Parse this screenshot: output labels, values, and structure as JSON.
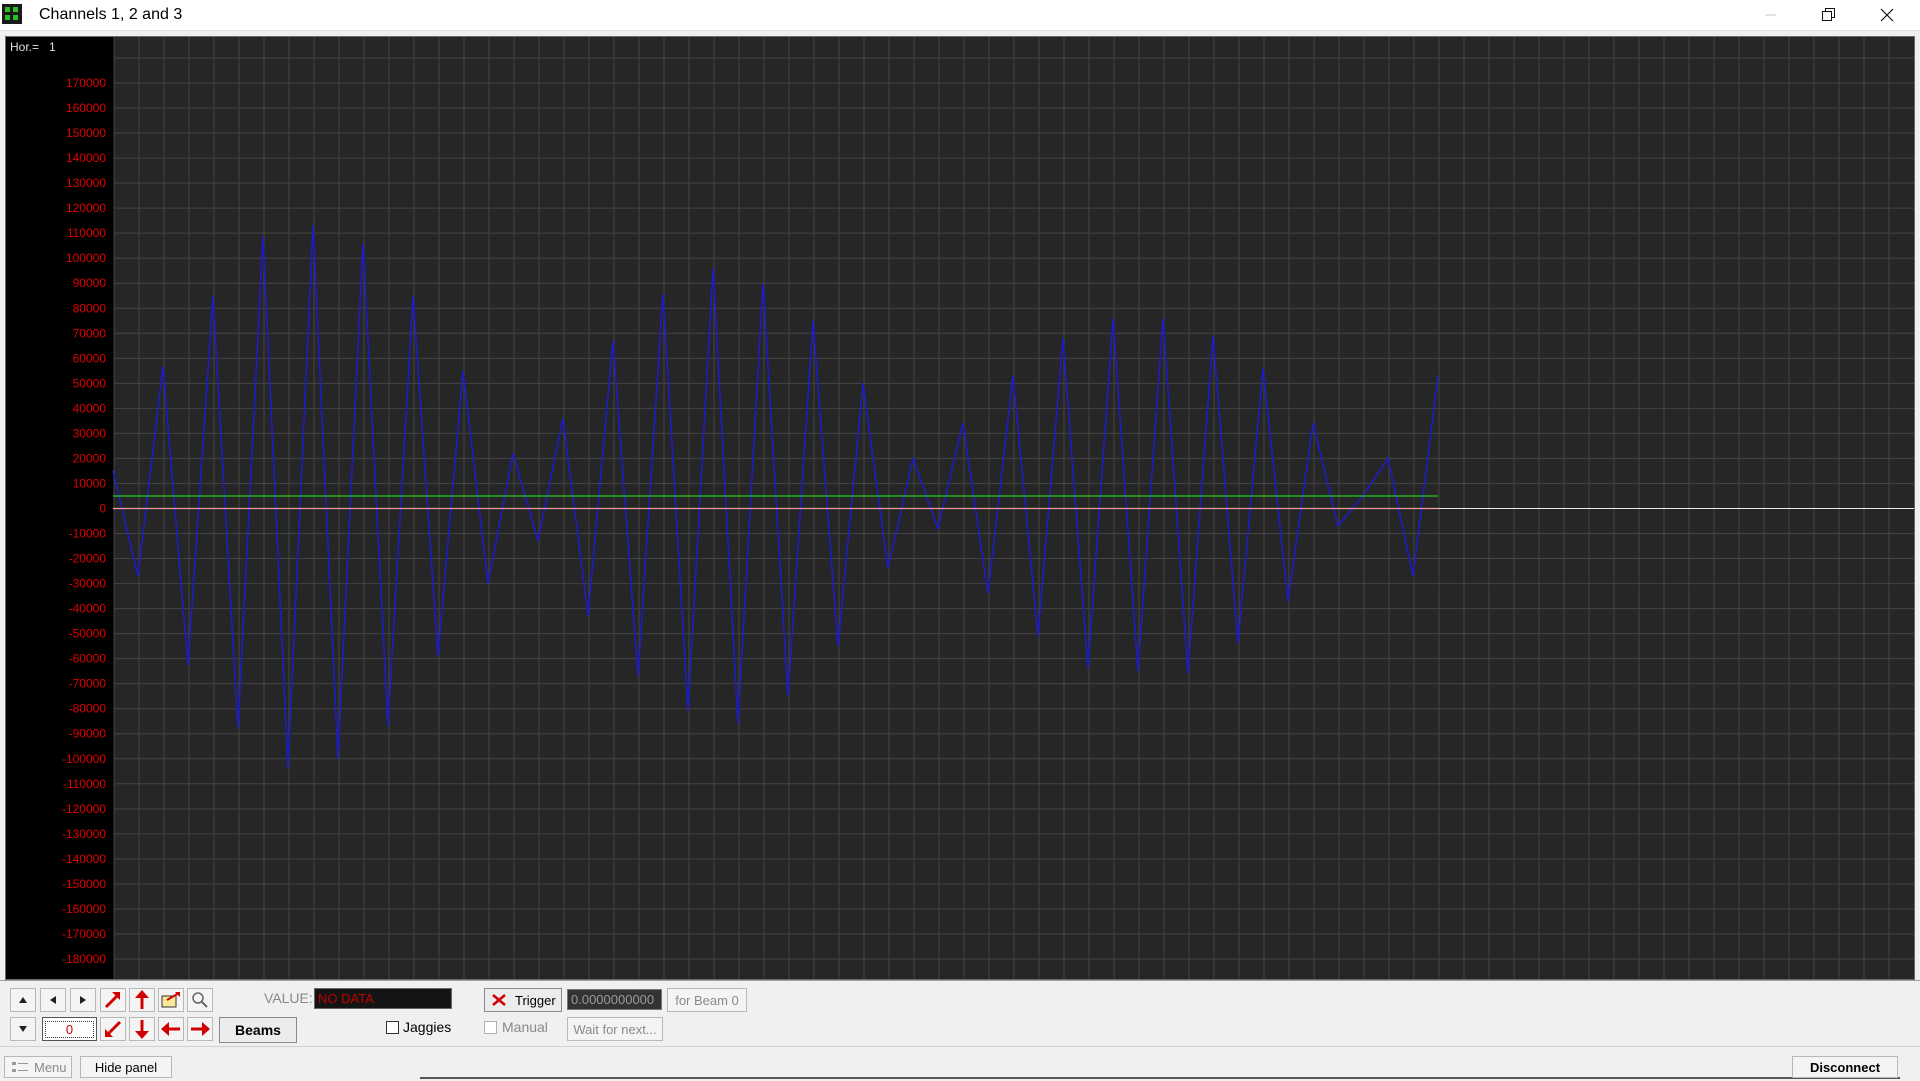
{
  "window": {
    "title": "Channels 1, 2 and 3"
  },
  "plot": {
    "hor_label": "Hor.=",
    "hor_value": "1"
  },
  "chart_data": {
    "type": "line",
    "ylim": [
      -180000,
      180000
    ],
    "ytick_step": 10000,
    "yticks": [
      "170000",
      "160000",
      "150000",
      "140000",
      "130000",
      "120000",
      "110000",
      "100000",
      "90000",
      "80000",
      "70000",
      "60000",
      "50000",
      "40000",
      "30000",
      "20000",
      "10000",
      "0",
      "-10000",
      "-20000",
      "-30000",
      "-40000",
      "-50000",
      "-60000",
      "-70000",
      "-80000",
      "-90000",
      "-100000",
      "-110000",
      "-120000",
      "-130000",
      "-140000",
      "-150000",
      "-160000",
      "-170000",
      "-180000"
    ],
    "x": [
      0,
      1,
      2,
      3,
      4,
      5,
      6,
      7,
      8,
      9,
      10,
      11,
      12,
      13,
      14,
      15,
      16,
      17,
      18,
      19,
      20,
      21,
      22,
      23,
      24,
      25,
      26,
      27,
      28,
      29,
      30,
      31,
      32,
      33,
      34,
      35,
      36,
      37,
      38,
      39,
      40,
      41,
      42,
      43,
      44,
      45,
      46,
      47,
      48,
      49,
      50,
      51,
      52,
      53,
      54,
      55
    ],
    "series": [
      {
        "color": "#1c1ccc",
        "values": [
          15000,
          -27000,
          57000,
          -63000,
          85000,
          -88000,
          109000,
          -104000,
          113000,
          -100000,
          106000,
          -87000,
          85000,
          -59000,
          55000,
          -30000,
          22000,
          -13000,
          36000,
          -43000,
          67000,
          -67000,
          86000,
          -81000,
          96000,
          -86000,
          90000,
          -75000,
          75000,
          -55000,
          50000,
          -24000,
          20000,
          -8000,
          34000,
          -34000,
          53000,
          -51000,
          68000,
          -64000,
          76000,
          -65000,
          76000,
          -66000,
          69000,
          -54000,
          56000,
          -37000,
          34000,
          -7000,
          5000,
          20000,
          -27000,
          53000
        ]
      },
      {
        "color": "#1fcc1f",
        "values": [
          5000,
          5000,
          5000,
          5000,
          5000,
          5000,
          5000,
          5000,
          5000,
          5000,
          5000,
          5000,
          5000,
          5000,
          5000,
          5000,
          5000,
          5000,
          5000,
          5000,
          5000,
          5000,
          5000,
          5000,
          5000,
          5000,
          5000,
          5000,
          5000,
          5000,
          5000,
          5000,
          5000,
          5000,
          5000,
          5000,
          5000,
          5000,
          5000,
          5000,
          5000,
          5000,
          5000,
          5000,
          5000,
          5000,
          5000,
          5000,
          5000,
          5000,
          5000,
          5000,
          5000,
          5000
        ]
      },
      {
        "color": "#ff9a9a",
        "values": [
          0,
          0,
          0,
          0,
          0,
          0,
          0,
          0,
          0,
          0,
          0,
          0,
          0,
          0,
          0,
          0,
          0,
          0,
          0,
          0,
          0,
          0,
          0,
          0,
          0,
          0,
          0,
          0,
          0,
          0,
          0,
          0,
          0,
          0,
          0,
          0,
          0,
          0,
          0,
          0,
          0,
          0,
          0,
          0,
          0,
          0,
          0,
          0,
          0,
          0,
          0,
          0,
          0,
          0
        ]
      }
    ],
    "grid": true,
    "background": "#000000",
    "tick_color": "#e00000"
  },
  "controls": {
    "value_label": "VALUE:",
    "value_text": "NO DATA",
    "beams_label": "Beams",
    "jaggies_label": "Jaggies",
    "trigger_label": "Trigger",
    "trigger_value": "0.0000000000",
    "for_beam_label": "for Beam 0",
    "manual_label": "Manual",
    "wait_label": "Wait for next...",
    "spin_value": "0"
  },
  "statusbar": {
    "menu_label": "Menu",
    "hide_panel_label": "Hide panel",
    "disconnect_label": "Disconnect"
  },
  "colors": {
    "plot_bg": "#000000",
    "grid": "#3a3a3a",
    "tick_labels": "#e00000"
  }
}
